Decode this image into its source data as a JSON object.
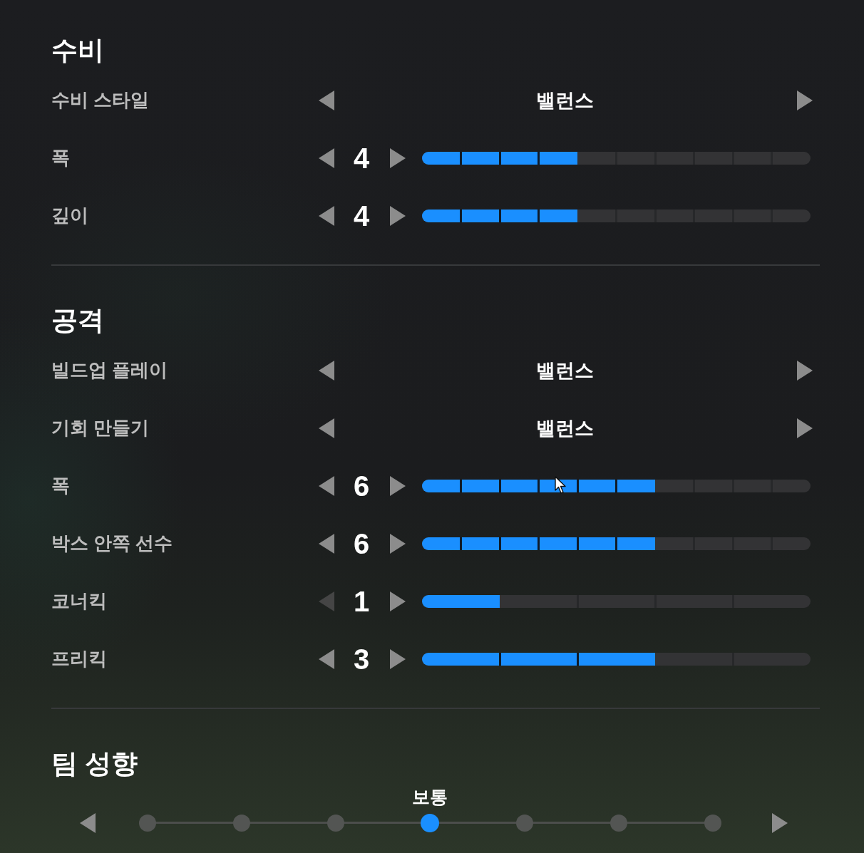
{
  "sections": [
    {
      "title": "수비",
      "rows": [
        {
          "kind": "choice",
          "label": "수비 스타일",
          "value": "밸런스",
          "prev_disabled": false,
          "next_disabled": false
        },
        {
          "kind": "stepper",
          "label": "폭",
          "value": "4",
          "level": 0.4,
          "prev_disabled": false,
          "next_disabled": false
        },
        {
          "kind": "stepper",
          "label": "깊이",
          "value": "4",
          "level": 0.4,
          "prev_disabled": false,
          "next_disabled": false
        }
      ]
    },
    {
      "title": "공격",
      "rows": [
        {
          "kind": "choice",
          "label": "빌드업 플레이",
          "value": "밸런스",
          "prev_disabled": false,
          "next_disabled": false
        },
        {
          "kind": "choice",
          "label": "기회 만들기",
          "value": "밸런스",
          "prev_disabled": false,
          "next_disabled": false
        },
        {
          "kind": "stepper",
          "label": "폭",
          "value": "6",
          "level": 0.6,
          "prev_disabled": false,
          "next_disabled": false
        },
        {
          "kind": "stepper",
          "label": "박스 안쪽 선수",
          "value": "6",
          "level": 0.6,
          "prev_disabled": false,
          "next_disabled": false
        },
        {
          "kind": "shortstepper",
          "label": "코너킥",
          "value": "1",
          "level": 0.2,
          "prev_disabled": true,
          "next_disabled": false
        },
        {
          "kind": "shortstepper",
          "label": "프리킥",
          "value": "3",
          "level": 0.6,
          "prev_disabled": false,
          "next_disabled": false
        }
      ]
    }
  ],
  "team_style": {
    "title": "팀 성향",
    "value": "보통",
    "prev_disabled": false,
    "next_disabled": false,
    "stops": [
      {
        "selected": false
      },
      {
        "selected": false
      },
      {
        "selected": false
      },
      {
        "selected": true
      },
      {
        "selected": false
      },
      {
        "selected": false
      },
      {
        "selected": false
      }
    ]
  }
}
